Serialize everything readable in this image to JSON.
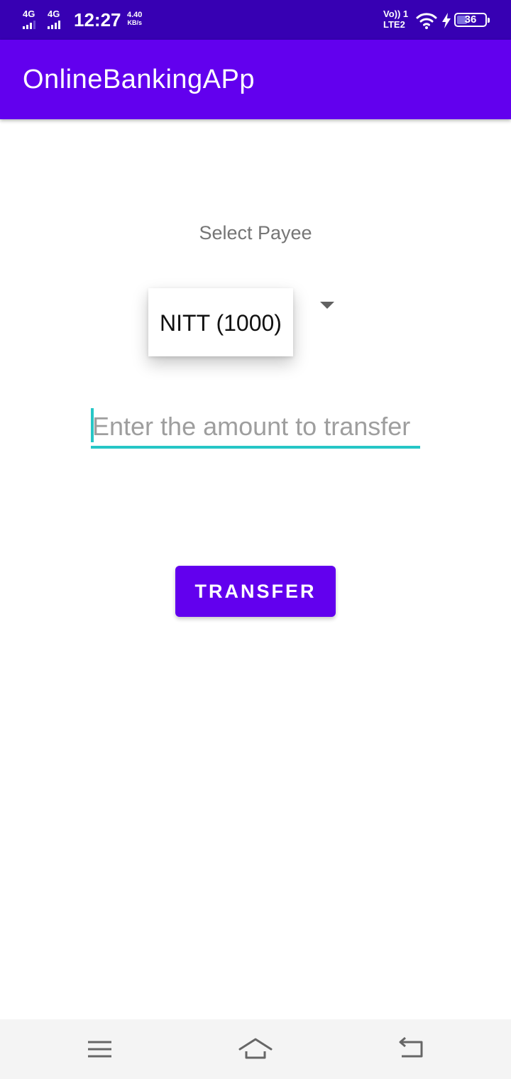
{
  "status_bar": {
    "sim1_network": "4G",
    "sim2_network": "4G",
    "time": "12:27",
    "speed_value": "4.40",
    "speed_unit": "KB/s",
    "volte_label": "Vo)) 1",
    "lte_label": "LTE2",
    "battery_level": "36",
    "battery_fraction": 0.36,
    "icons": [
      "signal-icon",
      "wifi-icon",
      "charging-icon",
      "battery-icon"
    ]
  },
  "app_bar": {
    "title": "OnlineBankingAPp"
  },
  "form": {
    "payee_label": "Select Payee",
    "selected_payee": "NITT (1000)",
    "amount_placeholder": "Enter the amount to transfer",
    "amount_value": "",
    "transfer_label": "TRANSFER"
  },
  "nav_bar": {
    "icons": [
      "menu-icon",
      "home-icon",
      "back-icon"
    ]
  },
  "colors": {
    "status_bar": "#3700b3",
    "primary": "#6200ee",
    "accent": "#26c6c6",
    "label_text": "#757575",
    "nav_bar": "#f4f4f4"
  }
}
